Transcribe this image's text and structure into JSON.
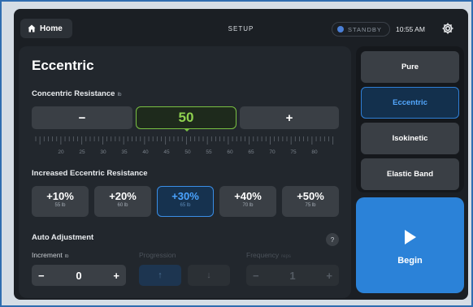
{
  "topbar": {
    "home_label": "Home",
    "screen_title": "SETUP",
    "status_label": "STANDBY",
    "time": "10:55 AM"
  },
  "panel": {
    "title": "Eccentric",
    "concentric": {
      "label": "Concentric Resistance",
      "unit": "lb",
      "minus": "−",
      "plus": "+",
      "value": "50",
      "ruler_ticks": [
        "20",
        "25",
        "30",
        "35",
        "40",
        "45",
        "50",
        "55",
        "60",
        "65",
        "70",
        "75",
        "80"
      ]
    },
    "eccentric": {
      "label": "Increased Eccentric Resistance",
      "options": [
        {
          "pct": "+10%",
          "lb": "55 lb"
        },
        {
          "pct": "+20%",
          "lb": "60 lb"
        },
        {
          "pct": "+30%",
          "lb": "65 lb"
        },
        {
          "pct": "+40%",
          "lb": "70 lb"
        },
        {
          "pct": "+50%",
          "lb": "75 lb"
        }
      ],
      "selected_index": 2
    },
    "auto_adjustment": {
      "label": "Auto Adjustment",
      "help": "?",
      "increment_label": "Increment",
      "increment_unit": "lb",
      "increment_value": "0",
      "progression_label": "Progression",
      "frequency_label": "Frequency",
      "frequency_unit": "reps",
      "frequency_value": "1",
      "minus": "−",
      "plus": "+",
      "up": "↑",
      "down": "↓"
    }
  },
  "modes": {
    "items": [
      "Pure",
      "Eccentric",
      "Isokinetic",
      "Elastic Band"
    ],
    "selected": "Eccentric"
  },
  "begin_label": "Begin",
  "colors": {
    "accent_blue": "#2b82d8",
    "value_green": "#8fd14f",
    "panel_bg": "#22272d"
  }
}
